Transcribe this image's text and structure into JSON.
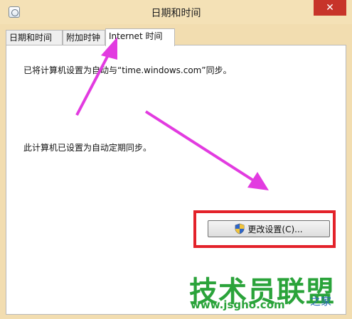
{
  "window": {
    "title": "日期和时间",
    "close_glyph": "✕"
  },
  "tabs": [
    {
      "label": "日期和时间",
      "active": false
    },
    {
      "label": "附加时钟",
      "active": false
    },
    {
      "label": "Internet 时间",
      "active": true
    }
  ],
  "panel": {
    "sync_info": "已将计算机设置为自动与“time.windows.com”同步。",
    "auto_sync_info": "此计算机已设置为自动定期同步。",
    "change_settings_label": "更改设置(C)..."
  },
  "watermark": {
    "brand": "技术员联盟",
    "url": "www.jsgho.com",
    "suffix": "之家"
  },
  "colors": {
    "annotation_arrow": "#e23be0",
    "highlight_box": "#e3222a",
    "watermark_green": "#2aa33a"
  }
}
